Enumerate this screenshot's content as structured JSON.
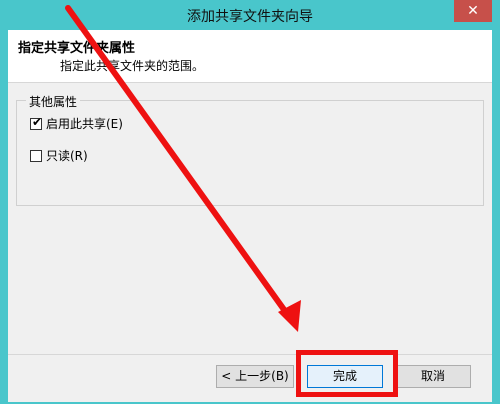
{
  "window": {
    "title": "添加共享文件夹向导",
    "close_glyph": "✕"
  },
  "header": {
    "title": "指定共享文件夹属性",
    "description": "指定此共享文件夹的范围。"
  },
  "group": {
    "label": "其他属性",
    "enable_sharing": {
      "label": "启用此共享(E)",
      "checked": true
    },
    "read_only": {
      "label": "只读(R)",
      "checked": false
    }
  },
  "buttons": {
    "back": "< 上一步(B)",
    "finish": "完成",
    "cancel": "取消"
  },
  "annotation": {
    "color": "#ee1111"
  }
}
